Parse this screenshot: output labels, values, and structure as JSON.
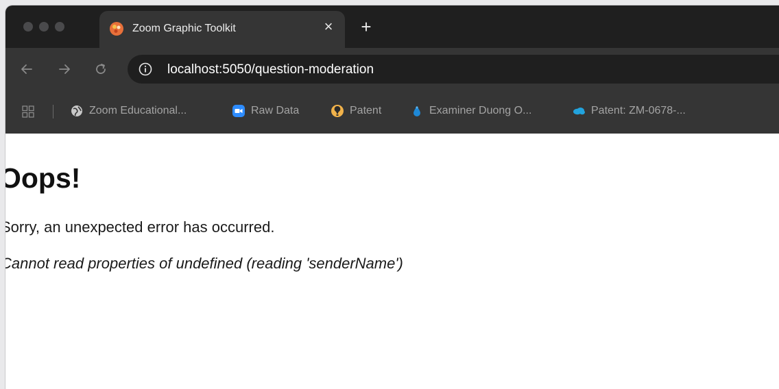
{
  "tab": {
    "title": "Zoom Graphic Toolkit",
    "close": "×",
    "new_tab": "+"
  },
  "address_bar": {
    "url": "localhost:5050/question-moderation"
  },
  "bookmarks": [
    {
      "label": "Zoom Educational...",
      "icon": "globe-icon"
    },
    {
      "label": "Raw Data",
      "icon": "zoom-video-icon"
    },
    {
      "label": "Patent",
      "icon": "patent-icon"
    },
    {
      "label": "Examiner Duong O...",
      "icon": "drop-icon"
    },
    {
      "label": "Patent: ZM-0678-...",
      "icon": "salesforce-cloud-icon"
    }
  ],
  "page": {
    "heading": "Oops!",
    "message": "Sorry, an unexpected error has occurred.",
    "error_detail": "Cannot read properties of undefined (reading 'senderName')"
  },
  "colors": {
    "titlebar": "#1f1f1f",
    "toolbar": "#353535",
    "page_background": "#ffffff"
  }
}
